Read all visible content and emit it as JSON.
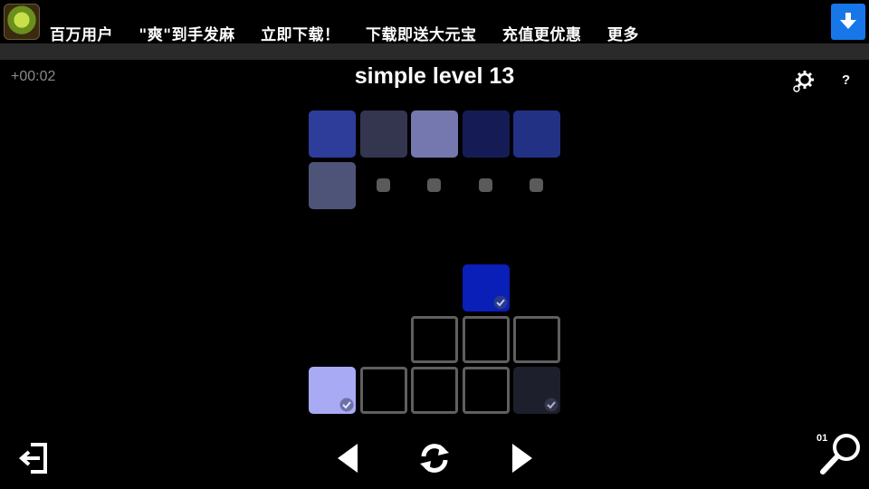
{
  "ad": {
    "items": [
      "百万用户",
      "\"爽\"到手发麻",
      "立即下载！",
      "下载即送大元宝",
      "充值更优惠",
      "更多"
    ],
    "download_icon": "down-arrow-icon",
    "accent": "#1877e8"
  },
  "game": {
    "timer": "+00:02",
    "title": "simple level 13",
    "help_label": "?",
    "hint_count": "01"
  },
  "palette": {
    "row1": [
      "#2e3d99",
      "#34364f",
      "#7478ae",
      "#151c55",
      "#233185"
    ],
    "row2": [
      "#4e5478"
    ],
    "placed_blue": "#0a1eb8",
    "placed_light": "#a8aaf4",
    "placed_dark": "#1e1f2c"
  },
  "icons": {
    "settings": "gear-icon",
    "exit": "exit-icon",
    "prev": "triangle-left-icon",
    "reset": "refresh-icon",
    "next": "triangle-right-icon",
    "hint": "magnifier-icon"
  }
}
